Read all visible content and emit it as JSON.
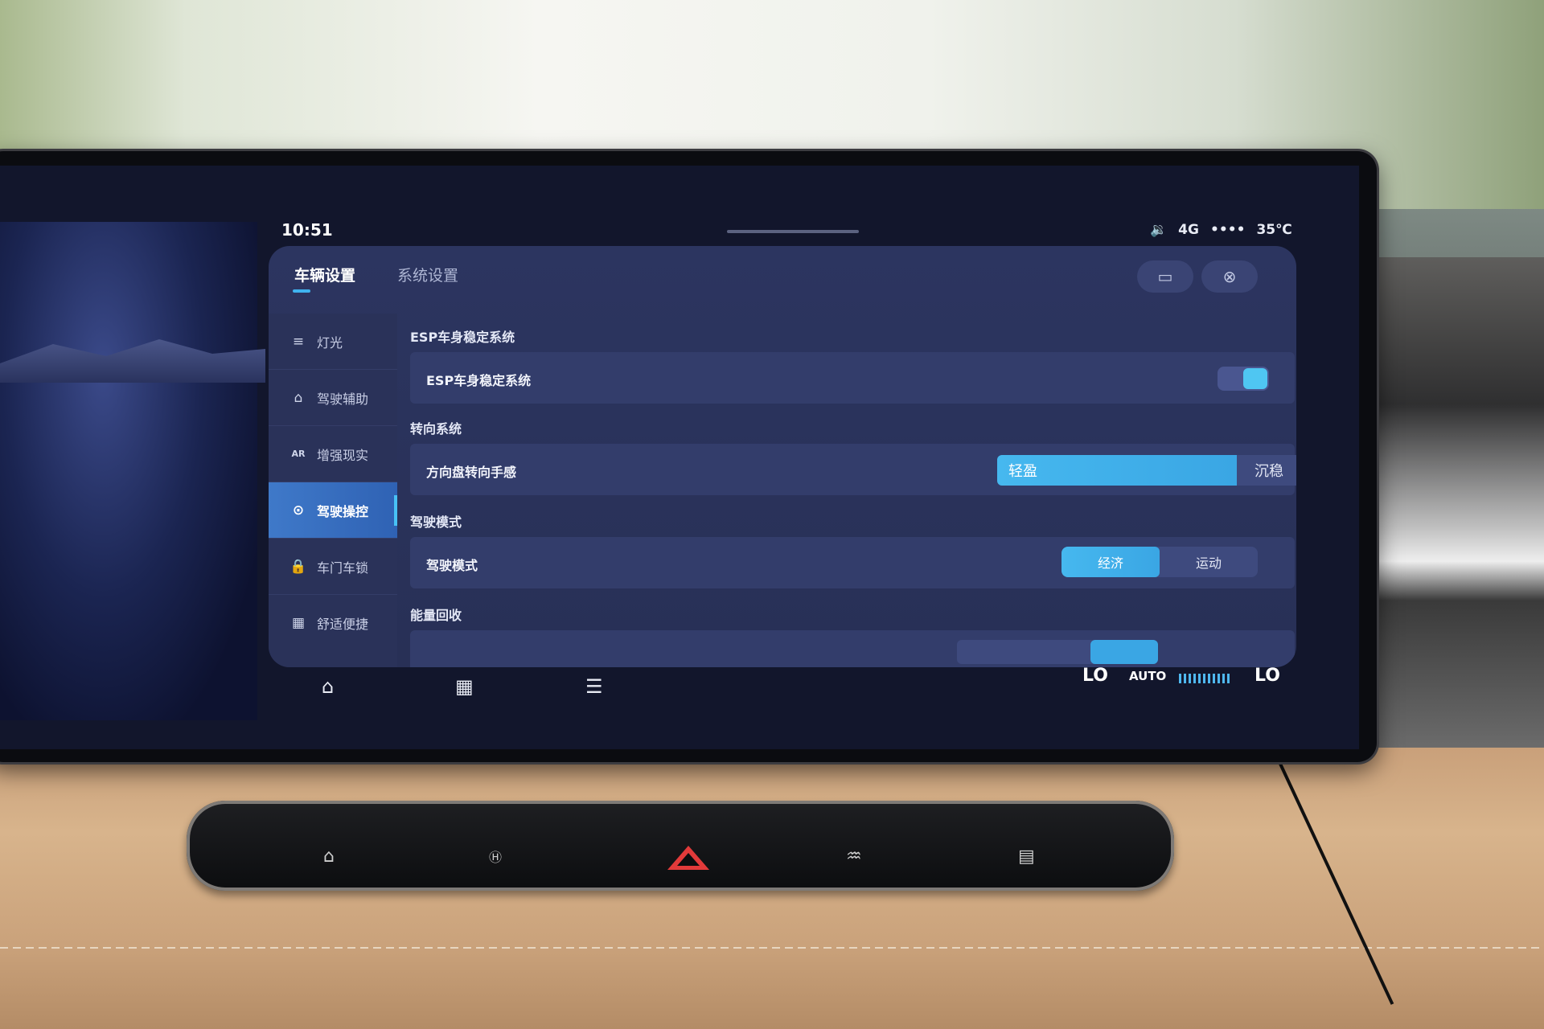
{
  "status_bar": {
    "time": "10:51",
    "volume_icon": "🔉",
    "network": "4G",
    "signal": "••••",
    "temperature": "35℃"
  },
  "tabs": [
    {
      "label": "车辆设置",
      "active": true
    },
    {
      "label": "系统设置",
      "active": false
    }
  ],
  "header_buttons": {
    "screen_icon": "screen-toggle-icon",
    "close_glyph": "⊗"
  },
  "sidebar": {
    "items": [
      {
        "label": "灯光",
        "icon": "headlight-icon",
        "glyph": "≡",
        "active": false
      },
      {
        "label": "驾驶辅助",
        "icon": "driving-assist-icon",
        "glyph": "⌂",
        "active": false
      },
      {
        "label": "增强现实",
        "icon": "ar-icon",
        "glyph": "AR",
        "active": false
      },
      {
        "label": "驾驶操控",
        "icon": "steering-wheel-icon",
        "glyph": "⊙",
        "active": true
      },
      {
        "label": "车门车锁",
        "icon": "lock-icon",
        "glyph": "🔒",
        "active": false
      },
      {
        "label": "舒适便捷",
        "icon": "grid-icon",
        "glyph": "▦",
        "active": false
      }
    ]
  },
  "sections": {
    "esp": {
      "title": "ESP车身稳定系统",
      "row_label": "ESP车身稳定系统",
      "enabled": true
    },
    "steering": {
      "title": "转向系统",
      "row_label": "方向盘转向手感",
      "options": [
        "轻盈",
        "沉稳"
      ],
      "selected": 0
    },
    "drive_mode": {
      "title": "驾驶模式",
      "row_label": "驾驶模式",
      "options": [
        "经济",
        "运动"
      ],
      "selected": 0
    },
    "energy": {
      "title": "能量回收"
    }
  },
  "dock": {
    "home_glyph": "⌂",
    "apps_glyph": "▦",
    "settings_glyph": "☰"
  },
  "climate": {
    "left_temp": "LO",
    "mode": "AUTO",
    "right_temp": "LO"
  },
  "colors": {
    "accent": "#46b8ef",
    "panel": "#2c3560",
    "row": "#333d6b",
    "hazard": "#e23a3a"
  }
}
